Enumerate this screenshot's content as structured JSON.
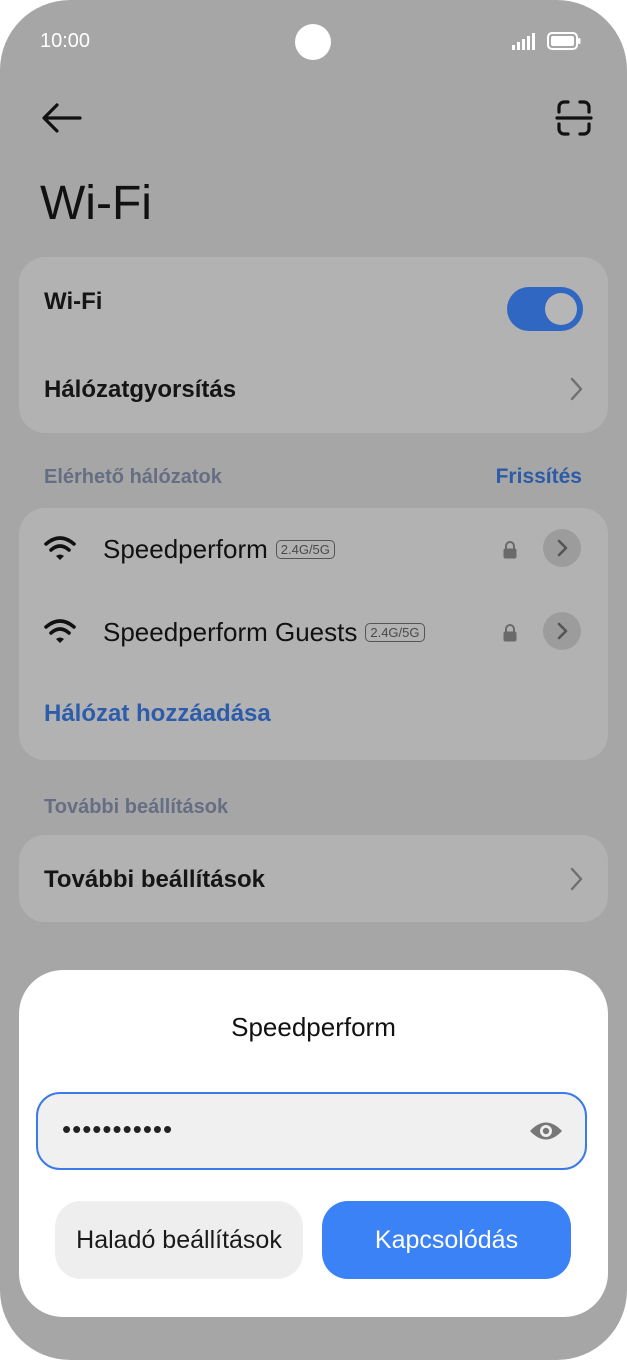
{
  "status_bar": {
    "time": "10:00"
  },
  "header": {
    "title": "Wi-Fi",
    "back_icon": "arrow-left-icon",
    "scan_icon": "scan-qr-icon"
  },
  "wifi_card": {
    "wifi_label": "Wi-Fi",
    "wifi_enabled": true,
    "accel_label": "Hálózatgyorsítás"
  },
  "available": {
    "section_label": "Elérhető hálózatok",
    "refresh_label": "Frissítés",
    "networks": [
      {
        "name": "Speedperform",
        "band": "2.4G/5G",
        "secured": true
      },
      {
        "name": "Speedperform Guests",
        "band": "2.4G/5G",
        "secured": true
      }
    ],
    "add_network_label": "Hálózat hozzáadása"
  },
  "more": {
    "section_label": "További beállítások",
    "row_label": "További beállítások"
  },
  "dialog": {
    "title": "Speedperform",
    "password_value": "•••••••••••",
    "advanced_label": "Haladó beállítások",
    "connect_label": "Kapcsolódás"
  },
  "colors": {
    "accent": "#3b82f6",
    "toggle_on": "#2f67c2",
    "link": "#2d5cab",
    "overlay": "#a6a6a6"
  }
}
